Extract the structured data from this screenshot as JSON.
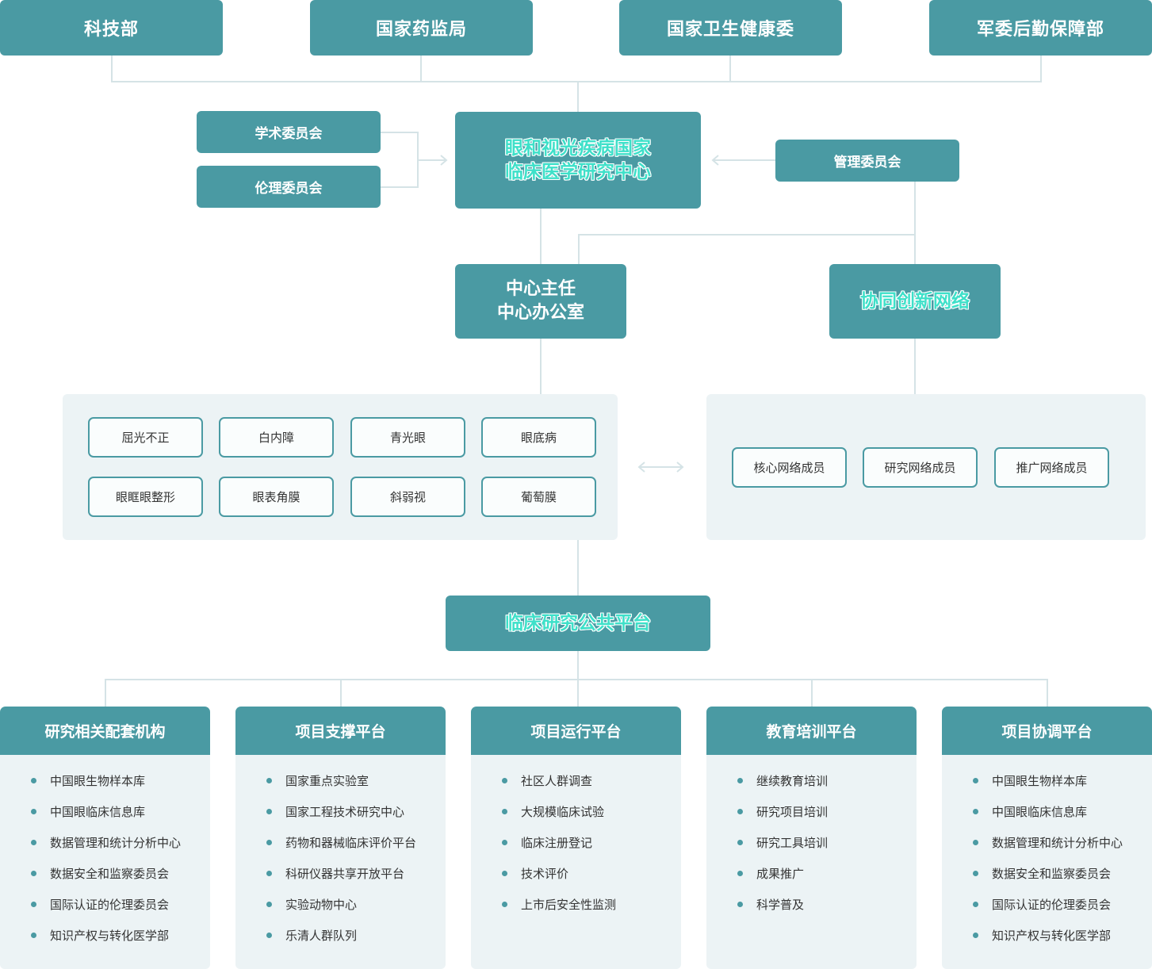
{
  "top_orgs": [
    "科技部",
    "国家药监局",
    "国家卫生健康委",
    "军委后勤保障部"
  ],
  "committees": {
    "academic": "学术委员会",
    "ethics": "伦理委员会",
    "management": "管理委员会"
  },
  "center": {
    "line1": "眼和视光疾病国家",
    "line2": "临床医学研究中心"
  },
  "director": {
    "line1": "中心主任",
    "line2": "中心办公室"
  },
  "network": {
    "title": "协同创新网络",
    "members": [
      "核心网络成员",
      "研究网络成员",
      "推广网络成员"
    ]
  },
  "specialties": [
    "屈光不正",
    "白内障",
    "青光眼",
    "眼底病",
    "眼眶眼整形",
    "眼表角膜",
    "斜弱视",
    "葡萄膜"
  ],
  "platform": {
    "title": "临床研究公共平台"
  },
  "columns": [
    {
      "title": "研究相关配套机构",
      "items": [
        "中国眼生物样本库",
        "中国眼临床信息库",
        "数据管理和统计分析中心",
        "数据安全和监察委员会",
        "国际认证的伦理委员会",
        "知识产权与转化医学部"
      ]
    },
    {
      "title": "项目支撑平台",
      "items": [
        "国家重点实验室",
        "国家工程技术研究中心",
        "药物和器械临床评价平台",
        "科研仪器共享开放平台",
        "实验动物中心",
        "乐清人群队列"
      ]
    },
    {
      "title": "项目运行平台",
      "items": [
        "社区人群调查",
        "大规模临床试验",
        "临床注册登记",
        "技术评价",
        "上市后安全性监测"
      ]
    },
    {
      "title": "教育培训平台",
      "items": [
        "继续教育培训",
        "研究项目培训",
        "研究工具培训",
        "成果推广",
        "科学普及"
      ]
    },
    {
      "title": "项目协调平台",
      "items": [
        "中国眼生物样本库",
        "中国眼临床信息库",
        "数据管理和统计分析中心",
        "数据安全和监察委员会",
        "国际认证的伦理委员会",
        "知识产权与转化医学部"
      ]
    }
  ],
  "colors": {
    "teal": "#4a9aa3",
    "panel": "#ecf3f5",
    "line": "#d5e3e6",
    "highlight": "#3ee0c9"
  }
}
